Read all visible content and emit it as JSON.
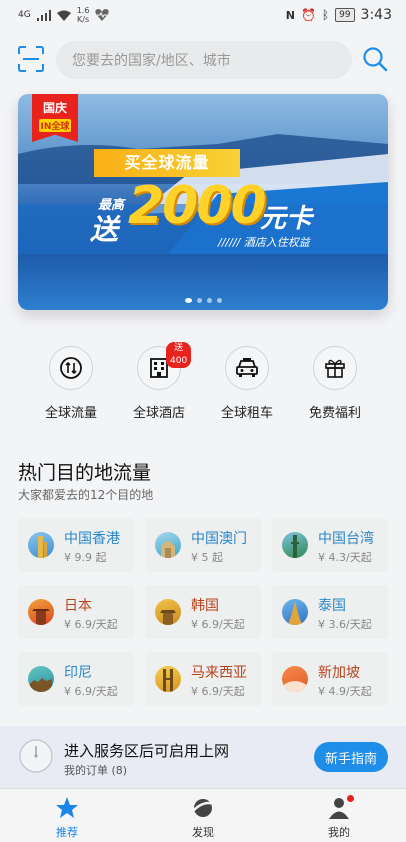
{
  "status": {
    "signal": "4G",
    "net_speed_value": "1.6",
    "net_speed_unit": "K/s",
    "battery": "99",
    "time": "3:43"
  },
  "search": {
    "placeholder": "您要去的国家/地区、城市"
  },
  "banner": {
    "badge_line1": "国庆",
    "badge_line2": "IN全球",
    "tag": "买全球流量",
    "prefix_small": "最高",
    "prefix_big": "送",
    "amount": "2000",
    "suffix": "元卡",
    "subtitle": "////// 酒店入住权益",
    "pages": 4,
    "active_page": 1
  },
  "quick_actions": [
    {
      "label": "全球流量",
      "icon": "traffic-icon",
      "badge": ""
    },
    {
      "label": "全球酒店",
      "icon": "hotel-icon",
      "badge": "送400"
    },
    {
      "label": "全球租车",
      "icon": "car-icon",
      "badge": ""
    },
    {
      "label": "免费福利",
      "icon": "gift-icon",
      "badge": ""
    }
  ],
  "popular": {
    "title": "热门目的地流量",
    "subtitle": "大家都爱去的12个目的地",
    "destinations": [
      {
        "name": "中国香港",
        "price": "¥ 9.9 起",
        "color": "#2a86c8"
      },
      {
        "name": "中国澳门",
        "price": "¥ 5 起",
        "color": "#2a86c8"
      },
      {
        "name": "中国台湾",
        "price": "¥ 4.3/天起",
        "color": "#2a86c8"
      },
      {
        "name": "日本",
        "price": "¥ 6.9/天起",
        "color": "#b8431e"
      },
      {
        "name": "韩国",
        "price": "¥ 6.9/天起",
        "color": "#b8431e"
      },
      {
        "name": "泰国",
        "price": "¥ 3.6/天起",
        "color": "#2a86c8"
      },
      {
        "name": "印尼",
        "price": "¥ 6.9/天起",
        "color": "#2a86c8"
      },
      {
        "name": "马来西亚",
        "price": "¥ 6.9/天起",
        "color": "#b8431e"
      },
      {
        "name": "新加坡",
        "price": "¥ 4.9/天起",
        "color": "#b8431e"
      }
    ]
  },
  "notice": {
    "title": "进入服务区后可启用上网",
    "subtitle": "我的订单 (8)",
    "button": "新手指南"
  },
  "nav": {
    "items": [
      {
        "label": "推荐",
        "icon": "star-icon",
        "active": true
      },
      {
        "label": "发现",
        "icon": "planet-icon",
        "active": false
      },
      {
        "label": "我的",
        "icon": "person-icon",
        "active": false
      }
    ]
  },
  "colors": {
    "accent": "#1e8ee8",
    "badge_red": "#e8221c",
    "nav_active": "#1a86e8"
  }
}
